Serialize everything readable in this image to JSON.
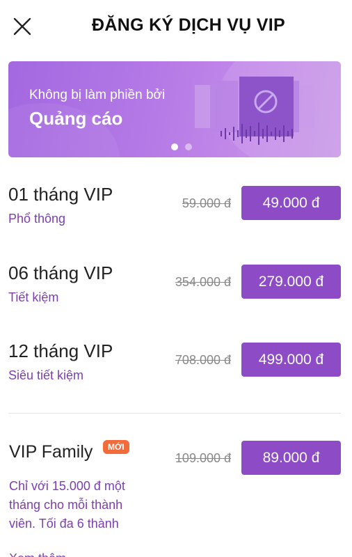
{
  "header": {
    "title": "ĐĂNG KÝ DỊCH VỤ VIP",
    "close_icon": "close-icon"
  },
  "banner": {
    "subtitle": "Không bị làm phiền bởi",
    "headline": "Quảng cáo",
    "art_icon": "no-ads-icon",
    "slides_total": 2,
    "active_slide": 1
  },
  "plans": [
    {
      "name": "01 tháng VIP",
      "tier": "Phổ thông",
      "old_price": "59.000 đ",
      "price": "49.000 đ"
    },
    {
      "name": "06 tháng VIP",
      "tier": "Tiết kiệm",
      "old_price": "354.000 đ",
      "price": "279.000 đ"
    },
    {
      "name": "12 tháng VIP",
      "tier": "Siêu tiết kiệm",
      "old_price": "708.000 đ",
      "price": "499.000 đ"
    }
  ],
  "family": {
    "name": "VIP Family",
    "badge": "MỚI",
    "description": "Chỉ với 15.000 đ một tháng cho mỗi thành viên. Tối đa 6 thành",
    "old_price": "109.000 đ",
    "price": "89.000 đ",
    "more_link": "Xem thêm"
  },
  "colors": {
    "accent": "#8d4bc6",
    "subtext": "#7b3fb0",
    "badge": "#f26b3a"
  }
}
